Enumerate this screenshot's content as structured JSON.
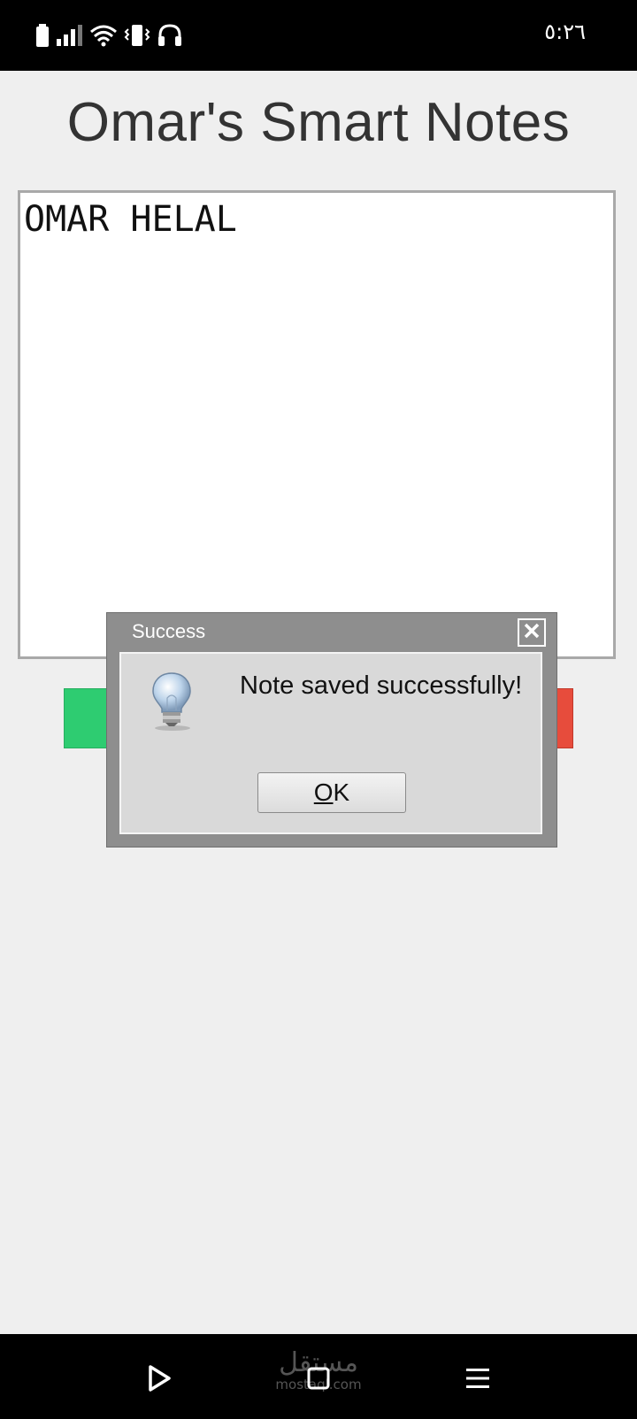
{
  "status_bar": {
    "time": "٥:٢٦",
    "icons": [
      "battery-icon",
      "signal-icon",
      "wifi-icon",
      "vibrate-icon",
      "headphones-icon"
    ]
  },
  "app": {
    "title": "Omar's Smart Notes",
    "note_text": "OMAR HELAL",
    "colors": {
      "save": "#2ecc71",
      "delete": "#e74c3c"
    }
  },
  "dialog": {
    "title": "Success",
    "message": "Note saved successfully!",
    "ok_mnemonic": "O",
    "ok_rest": "K",
    "icon": "lightbulb-icon"
  },
  "nav_bar": {
    "icons": [
      "play-icon",
      "home-square-icon",
      "menu-icon"
    ],
    "watermark_ar": "مستقل",
    "watermark_en": "mostaql.com"
  }
}
